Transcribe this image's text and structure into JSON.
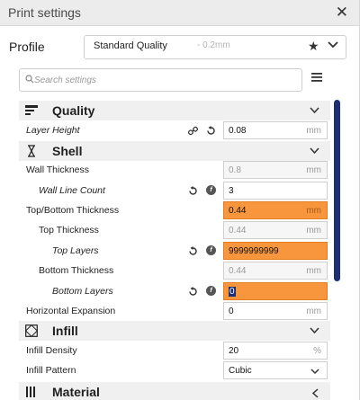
{
  "window": {
    "title": "Print settings",
    "close_icon": "close-icon"
  },
  "profile": {
    "label": "Profile",
    "name": "Standard Quality",
    "detail": " - 0.2mm"
  },
  "search": {
    "placeholder": "Search settings"
  },
  "categories": {
    "quality": {
      "label": "Quality",
      "icon": "quality-icon"
    },
    "shell": {
      "label": "Shell",
      "icon": "shell-icon"
    },
    "infill": {
      "label": "Infill",
      "icon": "infill-icon"
    },
    "material": {
      "label": "Material",
      "icon": "material-icon"
    }
  },
  "settings": {
    "layer_height": {
      "label": "Layer Height",
      "value": "0.08",
      "unit": "mm"
    },
    "wall_thickness": {
      "label": "Wall Thickness",
      "value": "0.8",
      "unit": "mm"
    },
    "wall_line_count": {
      "label": "Wall Line Count",
      "value": "3"
    },
    "top_bottom_thickness": {
      "label": "Top/Bottom Thickness",
      "value": "0.44",
      "unit": "mm"
    },
    "top_thickness": {
      "label": "Top Thickness",
      "value": "0.44",
      "unit": "mm"
    },
    "top_layers": {
      "label": "Top Layers",
      "value": "9999999999"
    },
    "bottom_thickness": {
      "label": "Bottom Thickness",
      "value": "0.44",
      "unit": "mm"
    },
    "bottom_layers": {
      "label": "Bottom Layers",
      "value": "0"
    },
    "horizontal_expansion": {
      "label": "Horizontal Expansion",
      "value": "0",
      "unit": "mm"
    },
    "infill_density": {
      "label": "Infill Density",
      "value": "20",
      "unit": "%"
    },
    "infill_pattern": {
      "label": "Infill Pattern",
      "value": "Cubic"
    }
  },
  "colors": {
    "warning": "#f8963d",
    "scrollbar": "#1c2f73"
  }
}
